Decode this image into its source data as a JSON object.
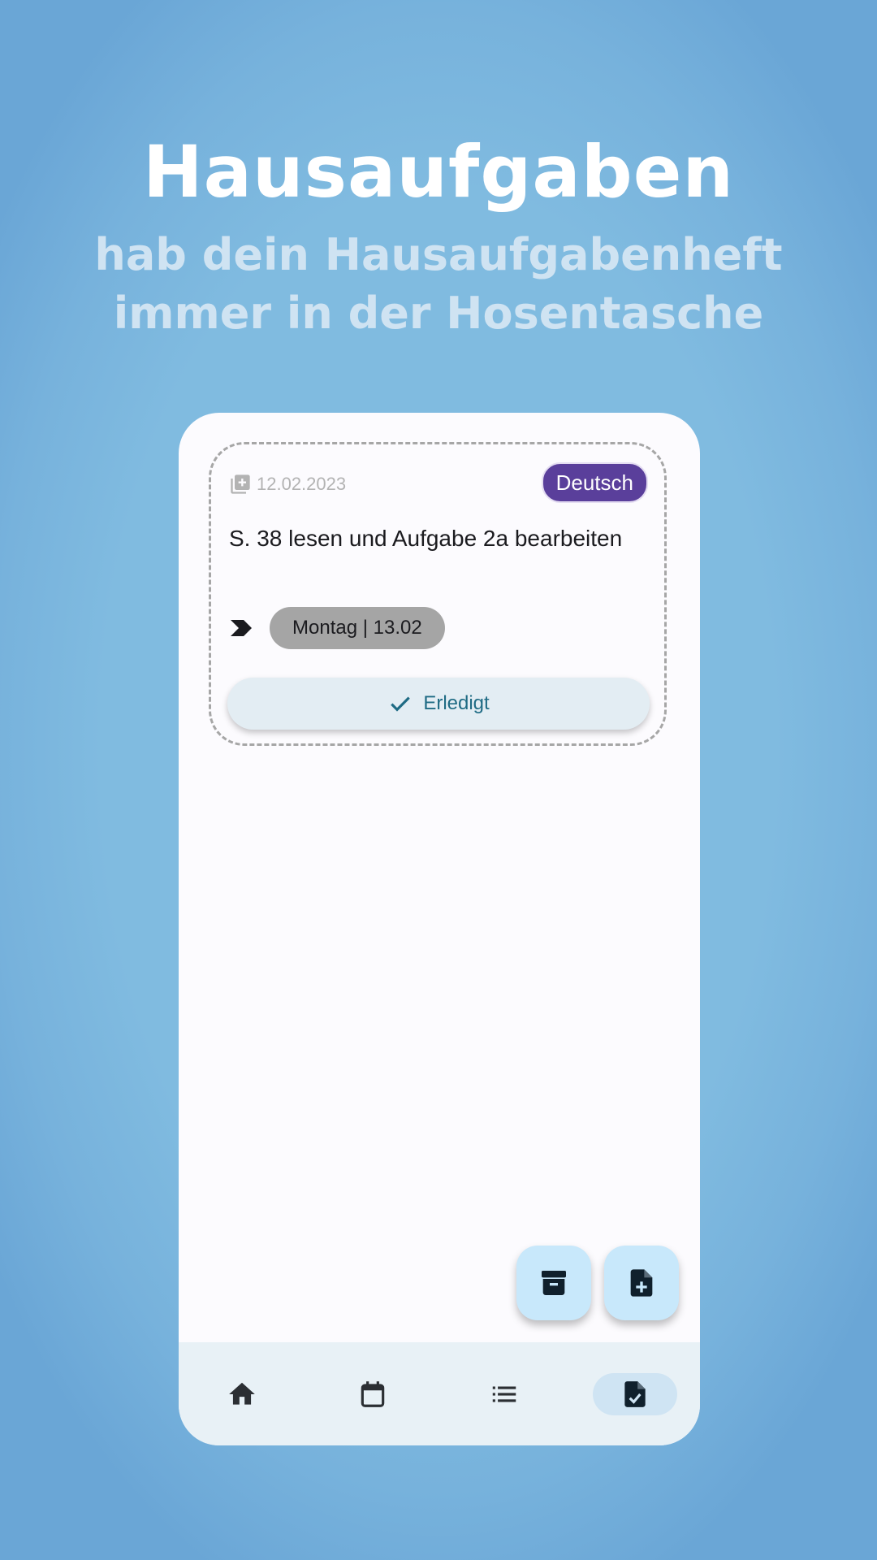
{
  "promo": {
    "title": "Hausaufgaben",
    "subtitle_line1": "hab dein Hausaufgabenheft",
    "subtitle_line2": "immer in der Hosentasche"
  },
  "homework_card": {
    "created_date": "12.02.2023",
    "subject": "Deutsch",
    "subject_color": "#5a3f9b",
    "task": "S. 38 lesen und Aufgabe 2a bearbeiten",
    "due": "Montag | 13.02",
    "done_label": "Erledigt"
  },
  "fabs": [
    {
      "icon": "archive-icon"
    },
    {
      "icon": "add-document-icon"
    }
  ],
  "nav": {
    "items": [
      {
        "icon": "home-icon"
      },
      {
        "icon": "calendar-icon"
      },
      {
        "icon": "list-icon"
      },
      {
        "icon": "homework-icon",
        "selected": true
      }
    ]
  },
  "colors": {
    "background": "#80bbe0",
    "fab_background": "#c8e8fb",
    "nav_background": "#e8f1f6",
    "accent": "#1f6b84"
  }
}
